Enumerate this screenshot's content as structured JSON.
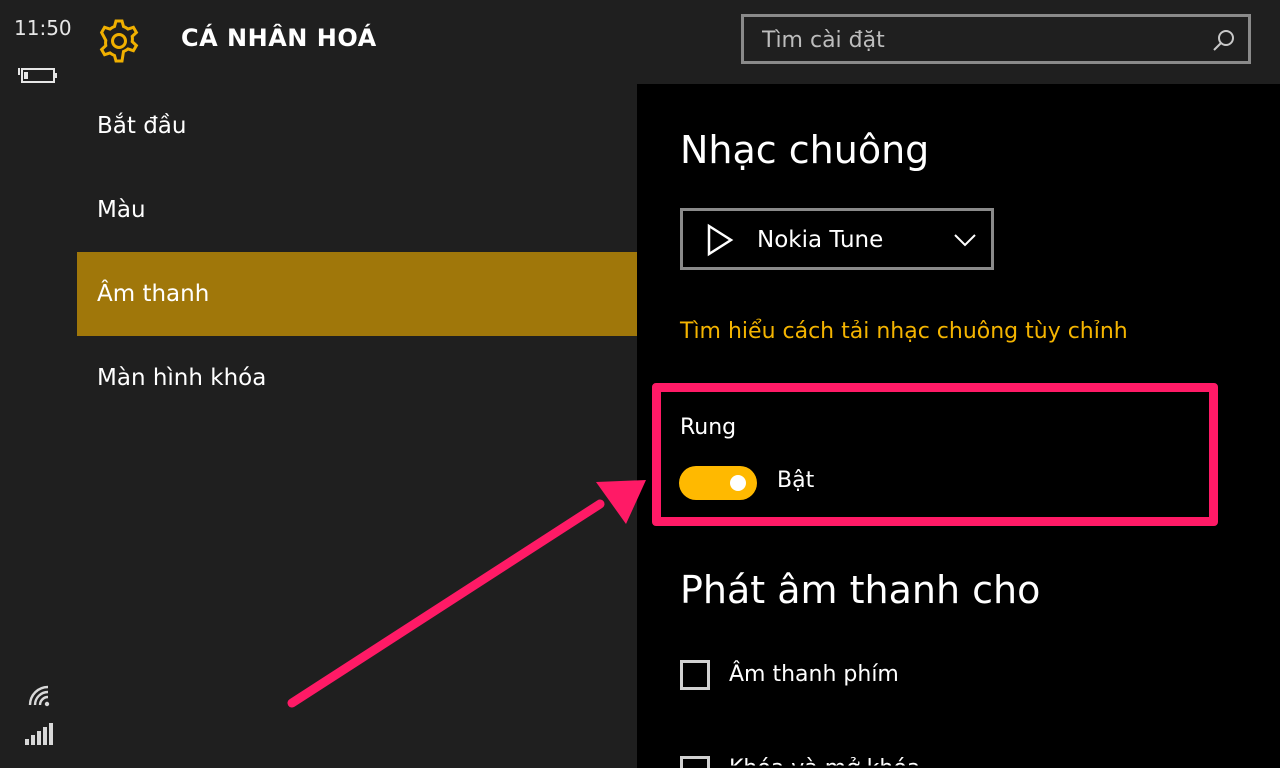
{
  "status": {
    "time": "11:50"
  },
  "header": {
    "title": "CÁ NHÂN HOÁ",
    "search_placeholder": "Tìm cài đặt"
  },
  "nav": {
    "items": [
      {
        "label": "Bắt đầu"
      },
      {
        "label": "Màu"
      },
      {
        "label": "Âm thanh",
        "active": true
      },
      {
        "label": "Màn hình khóa"
      }
    ]
  },
  "content": {
    "ringtone_heading": "Nhạc chuông",
    "ringtone_value": "Nokia Tune",
    "ringtone_link": "Tìm hiểu cách tải nhạc chuông tùy chỉnh",
    "vibrate_label": "Rung",
    "vibrate_state": "Bật",
    "play_sounds_heading": "Phát âm thanh cho",
    "checkboxes": [
      {
        "label": "Âm thanh phím"
      },
      {
        "label": "Khóa và mở khóa"
      }
    ]
  },
  "colors": {
    "accent": "#ffb900",
    "active_nav": "#a0770a",
    "link": "#f4b400",
    "annotation": "#ff1a66"
  }
}
